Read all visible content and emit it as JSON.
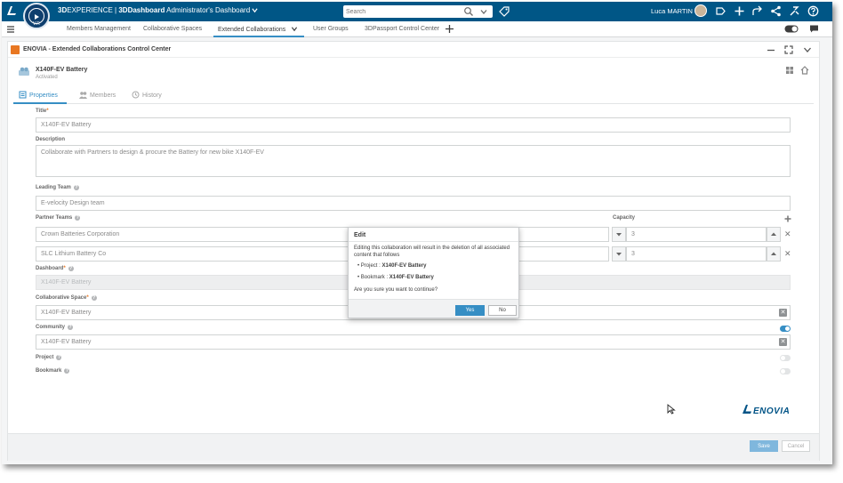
{
  "topbar": {
    "brand_3d": "3D",
    "brand_experience": "EXPERIENCE",
    "brand_separator": " | ",
    "brand_dashboard": "3DDashboard",
    "dashboard_name": "Administrator's Dashboard",
    "compass_version": "V.R",
    "search_placeholder": "Search",
    "user_name": "Luca MARTIN"
  },
  "tabs": [
    {
      "label": "Members Management"
    },
    {
      "label": "Collaborative Spaces"
    },
    {
      "label": "Extended Collaborations"
    },
    {
      "label": "User Groups"
    },
    {
      "label": "3DPassport Control Center"
    }
  ],
  "widget": {
    "title": "ENOVIA - Extended Collaborations Control Center",
    "object_name": "X140F-EV Battery",
    "object_status": "Activated"
  },
  "subtabs": [
    {
      "label": "Properties"
    },
    {
      "label": "Members"
    },
    {
      "label": "History"
    }
  ],
  "form": {
    "title_label": "Title",
    "title_value": "X140F-EV Battery",
    "description_label": "Description",
    "description_value": "Collaborate with Partners to design & procure the Battery for new bike X140F-EV",
    "leading_team_label": "Leading Team",
    "leading_team_value": "E-velocity Design team",
    "partner_teams_label": "Partner Teams",
    "capacity_label": "Capacity",
    "partners": [
      {
        "name": "Crown Batteries Corporation",
        "capacity": "3"
      },
      {
        "name": "SLC Lithium Battery Co",
        "capacity": "3"
      }
    ],
    "dashboard_label": "Dashboard",
    "dashboard_value": "X140F-EV Battery",
    "collab_space_label": "Collaborative Space",
    "collab_space_value": "X140F-EV Battery",
    "community_label": "Community",
    "community_value": "X140F-EV Battery",
    "community_enabled": true,
    "project_label": "Project",
    "project_enabled": false,
    "bookmark_label": "Bookmark",
    "bookmark_enabled": false,
    "required_mark": "*",
    "help_mark": "?"
  },
  "footer": {
    "save_label": "Save",
    "cancel_label": "Cancel",
    "brand": "ENOVIA"
  },
  "modal": {
    "title": "Edit",
    "message": "Editing this collaboration will result in the deletion of all associated content that follows",
    "items": [
      {
        "prefix": "Project : ",
        "value": "X140F-EV Battery"
      },
      {
        "prefix": "Bookmark : ",
        "value": "X140F-EV Battery"
      }
    ],
    "bullet": "•",
    "confirm": "Are you sure you want to continue?",
    "yes_label": "Yes",
    "no_label": "No"
  },
  "colors": {
    "topbar": "#005686",
    "accent": "#368ec4",
    "widget_icon": "#e87722",
    "brand": "#005386"
  },
  "icons": [
    "3ds-logo-icon",
    "compass-icon",
    "search-icon",
    "chevron-down-icon",
    "tag-icon",
    "share-icon",
    "plus-icon",
    "arrow-icon",
    "network-icon",
    "tools-icon",
    "help-icon",
    "menu-icon",
    "toggle-view-icon",
    "chat-icon",
    "minimize-icon",
    "expand-icon",
    "home-icon",
    "properties-icon",
    "members-icon",
    "history-icon",
    "clear-icon",
    "remove-icon"
  ]
}
